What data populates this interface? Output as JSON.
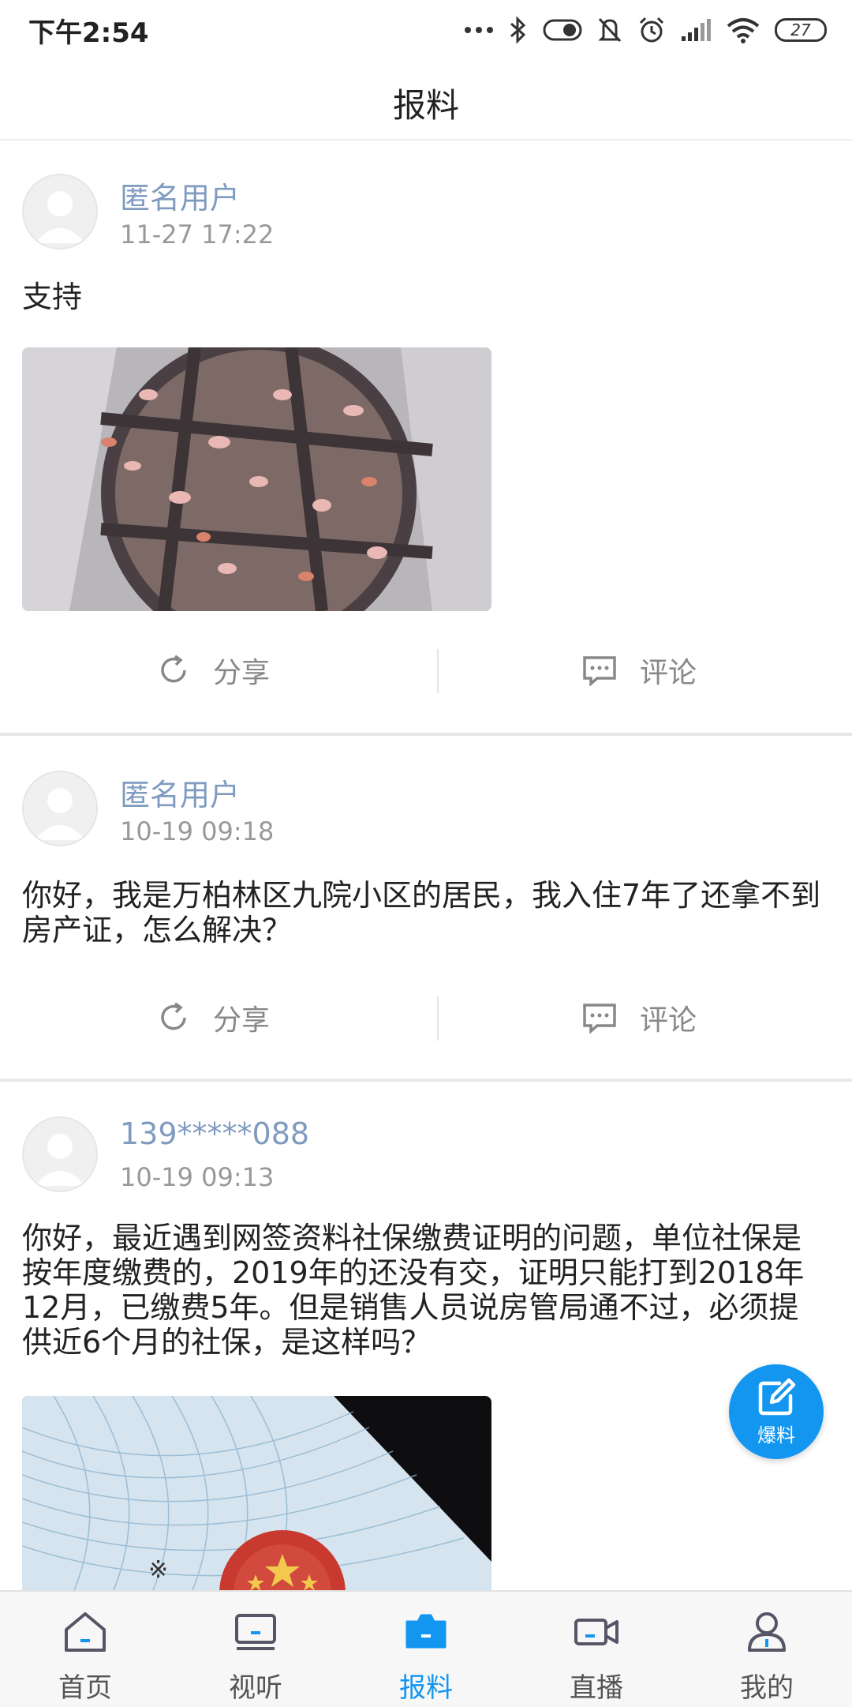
{
  "status_bar": {
    "time": "下午2:54",
    "battery": "27"
  },
  "header": {
    "title": "报料"
  },
  "posts": [
    {
      "user": "匿名用户",
      "time": "11-27 17:22",
      "text": "支持",
      "image": "manhole-cover-with-leaves",
      "share_label": "分享",
      "comment_label": "评论"
    },
    {
      "user": "匿名用户",
      "time": "10-19 09:18",
      "text": "你好，我是万柏林区九院小区的居民，我入住7年了还拿不到房产证，怎么解决？",
      "share_label": "分享",
      "comment_label": "评论"
    },
    {
      "user": "139*****088",
      "time": "10-19 09:13",
      "text": "你好，最近遇到网签资料社保缴费证明的问题，单位社保是按年度缴费的，2019年的还没有交，证明只能打到2018年12月，已缴费5年。但是销售人员说房管局通不过，必须提供近6个月的社保，是这样吗？",
      "image": "property-certificate"
    }
  ],
  "fab": {
    "label": "爆料",
    "icon": "edit-icon"
  },
  "bottom_nav": [
    {
      "label": "首页",
      "icon": "home-icon",
      "active": false
    },
    {
      "label": "视听",
      "icon": "tv-icon",
      "active": false
    },
    {
      "label": "报料",
      "icon": "camera-icon",
      "active": true
    },
    {
      "label": "直播",
      "icon": "video-camera-icon",
      "active": false
    },
    {
      "label": "我的",
      "icon": "user-icon",
      "active": false
    }
  ],
  "colors": {
    "accent": "#1296f0",
    "username": "#7f9bc0",
    "muted": "#999999"
  }
}
